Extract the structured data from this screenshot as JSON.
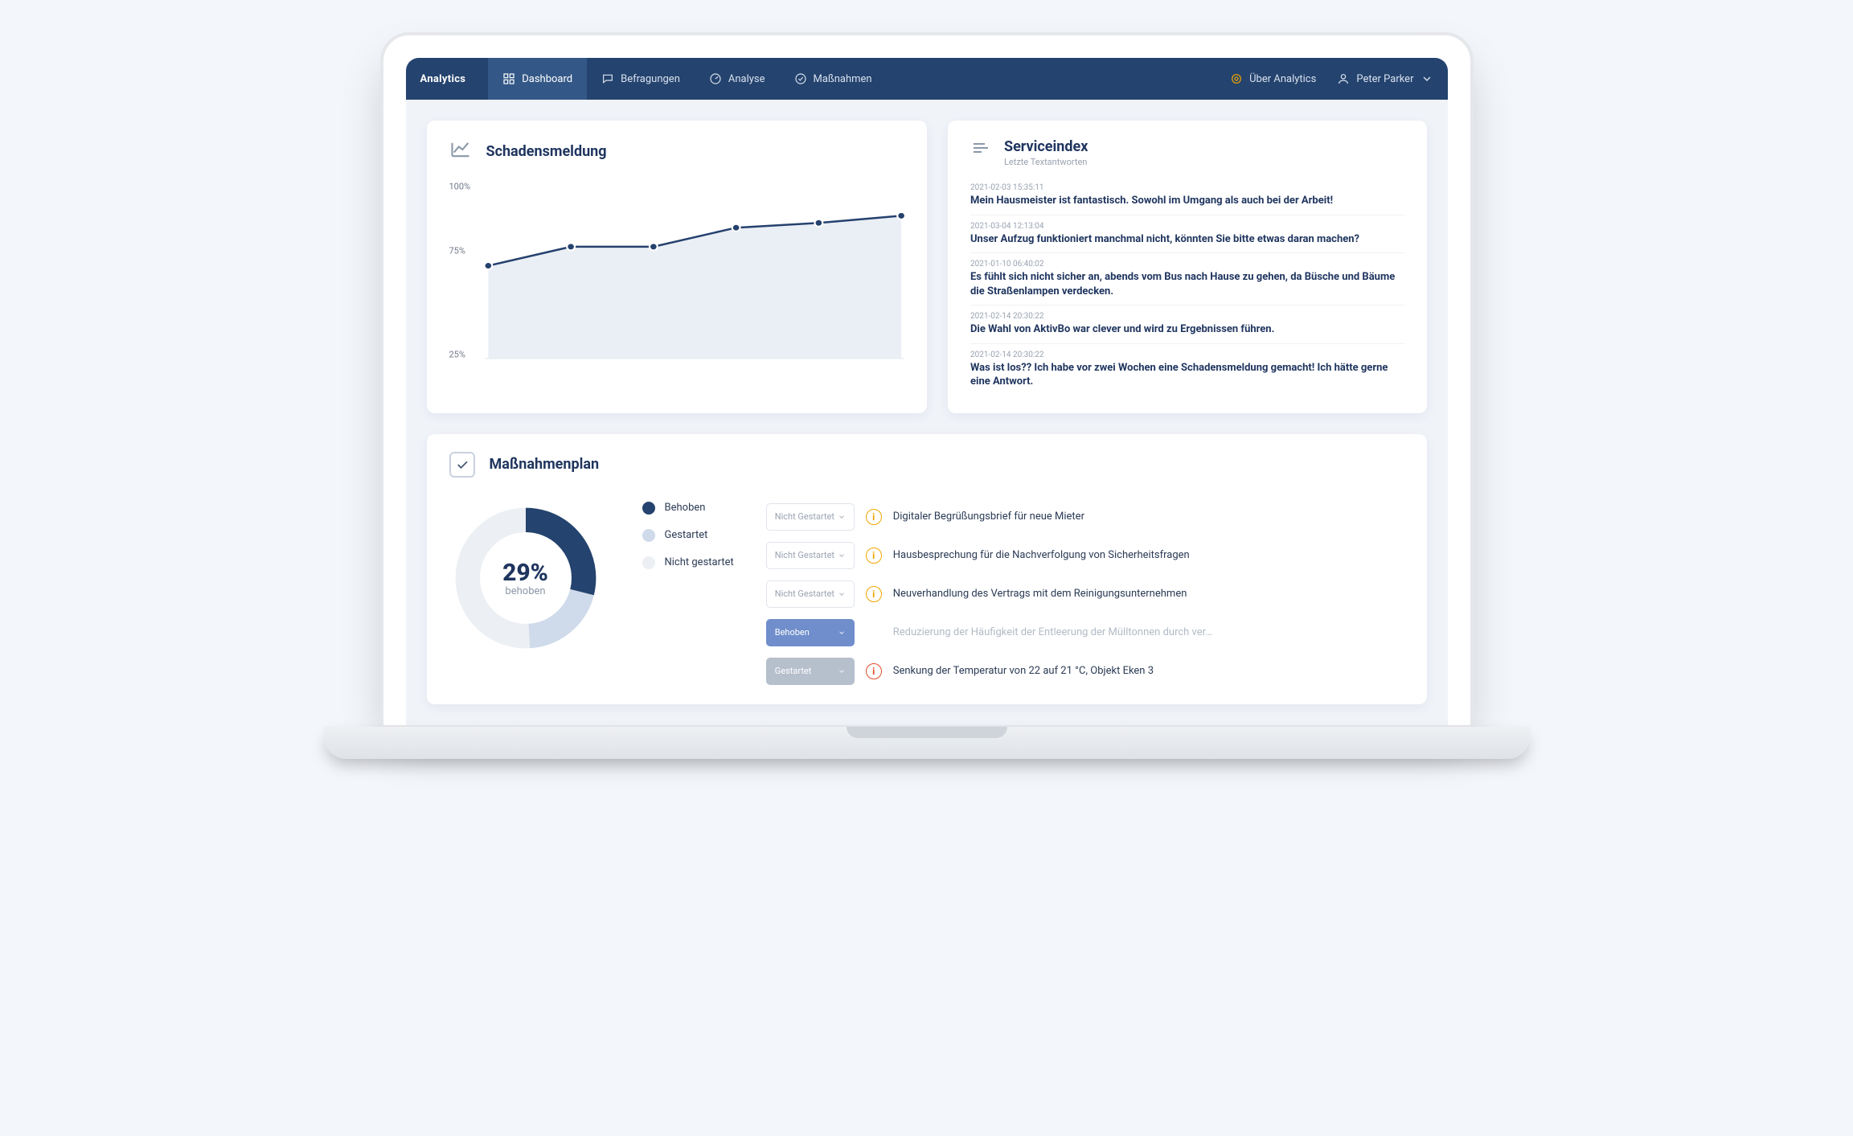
{
  "brand": "Analytics",
  "nav": [
    {
      "label": "Dashboard",
      "icon": "grid",
      "active": true
    },
    {
      "label": "Befragungen",
      "icon": "chat",
      "active": false
    },
    {
      "label": "Analyse",
      "icon": "gauge",
      "active": false
    },
    {
      "label": "Maßnahmen",
      "icon": "check",
      "active": false
    }
  ],
  "top_right": {
    "about": "Über Analytics",
    "user": "Peter Parker"
  },
  "schadensmeldung": {
    "title": "Schadensmeldung",
    "y_ticks": [
      "100%",
      "75%",
      "25%"
    ]
  },
  "chart_data": {
    "type": "line",
    "title": "Schadensmeldung",
    "ylabel": "%",
    "ylim": [
      25,
      100
    ],
    "y_ticks": [
      25,
      75,
      100
    ],
    "x": [
      0,
      1,
      2,
      3,
      4,
      5
    ],
    "values": [
      64,
      72,
      72,
      80,
      82,
      85
    ]
  },
  "serviceindex": {
    "title": "Serviceindex",
    "subtitle": "Letzte Textantworten",
    "items": [
      {
        "date": "2021-02-03 15:35:11",
        "text": "Mein Hausmeister ist fantastisch. Sowohl im Umgang als auch bei der Arbeit!"
      },
      {
        "date": "2021-03-04 12:13:04",
        "text": "Unser Aufzug funktioniert manchmal nicht, könnten Sie bitte etwas daran machen?"
      },
      {
        "date": "2021-01-10 06:40:02",
        "text": "Es fühlt sich nicht sicher an, abends vom Bus nach Hause zu gehen, da Büsche und Bäume die Straßenlampen verdecken."
      },
      {
        "date": "2021-02-14 20:30:22",
        "text": "Die Wahl von AktivBo war clever und wird zu Ergebnissen führen."
      },
      {
        "date": "2021-02-14 20:30:22",
        "text": "Was ist los?? Ich habe vor zwei Wochen eine Schadensmeldung gemacht! Ich hätte gerne eine Antwort."
      }
    ]
  },
  "actionplan": {
    "title": "Maßnahmenplan",
    "donut": {
      "value": "29%",
      "label": "behoben"
    },
    "legend": [
      {
        "label": "Behoben",
        "color": "#24436e"
      },
      {
        "label": "Gestartet",
        "color": "#cfdaea"
      },
      {
        "label": "Nicht gestartet",
        "color": "#eceff3"
      }
    ],
    "statuses": {
      "not_started": "Nicht Gestartet",
      "done": "Behoben",
      "started": "Gestartet"
    },
    "tasks": [
      {
        "status": "not_started",
        "prio": "amber",
        "title": "Digitaler Begrüßungsbrief für neue Mieter",
        "muted": false,
        "style": "outline"
      },
      {
        "status": "not_started",
        "prio": "amber",
        "title": "Hausbesprechung für die Nachverfolgung von Sicherheitsfragen",
        "muted": false,
        "style": "outline"
      },
      {
        "status": "not_started",
        "prio": "amber",
        "title": "Neuverhandlung des Vertrags mit dem Reinigungsunternehmen",
        "muted": false,
        "style": "outline"
      },
      {
        "status": "done",
        "prio": "none",
        "title": "Reduzierung der Häufigkeit der Entleerung der Mülltonnen durch ver…",
        "muted": true,
        "style": "solid-blue"
      },
      {
        "status": "started",
        "prio": "red",
        "title": "Senkung der Temperatur von 22 auf 21 °C, Objekt Eken 3",
        "muted": false,
        "style": "solid-grey"
      }
    ]
  },
  "colors": {
    "brand_dark": "#24436e",
    "brand_mid": "#335887"
  }
}
